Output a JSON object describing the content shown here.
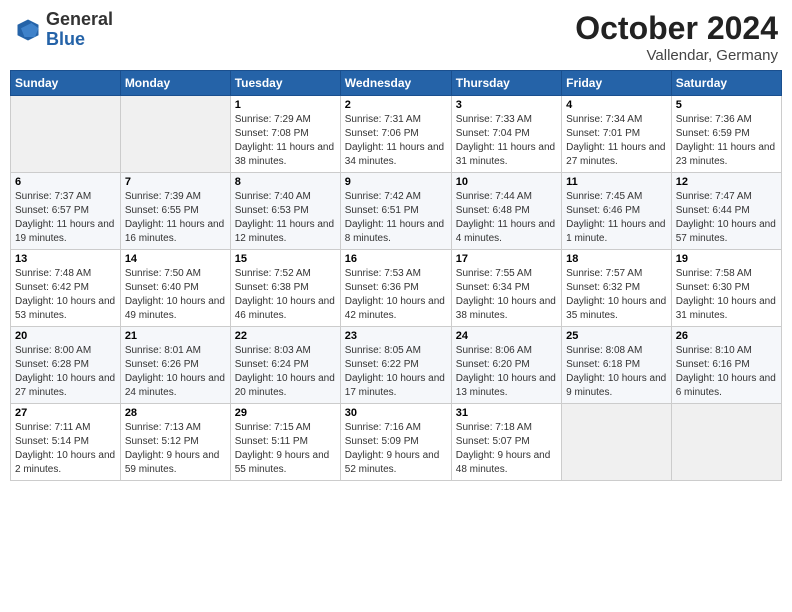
{
  "header": {
    "logo_general": "General",
    "logo_blue": "Blue",
    "month": "October 2024",
    "location": "Vallendar, Germany"
  },
  "weekdays": [
    "Sunday",
    "Monday",
    "Tuesday",
    "Wednesday",
    "Thursday",
    "Friday",
    "Saturday"
  ],
  "weeks": [
    [
      {
        "day": "",
        "info": ""
      },
      {
        "day": "",
        "info": ""
      },
      {
        "day": "1",
        "sunrise": "7:29 AM",
        "sunset": "7:08 PM",
        "daylight": "11 hours and 38 minutes."
      },
      {
        "day": "2",
        "sunrise": "7:31 AM",
        "sunset": "7:06 PM",
        "daylight": "11 hours and 34 minutes."
      },
      {
        "day": "3",
        "sunrise": "7:33 AM",
        "sunset": "7:04 PM",
        "daylight": "11 hours and 31 minutes."
      },
      {
        "day": "4",
        "sunrise": "7:34 AM",
        "sunset": "7:01 PM",
        "daylight": "11 hours and 27 minutes."
      },
      {
        "day": "5",
        "sunrise": "7:36 AM",
        "sunset": "6:59 PM",
        "daylight": "11 hours and 23 minutes."
      }
    ],
    [
      {
        "day": "6",
        "sunrise": "7:37 AM",
        "sunset": "6:57 PM",
        "daylight": "11 hours and 19 minutes."
      },
      {
        "day": "7",
        "sunrise": "7:39 AM",
        "sunset": "6:55 PM",
        "daylight": "11 hours and 16 minutes."
      },
      {
        "day": "8",
        "sunrise": "7:40 AM",
        "sunset": "6:53 PM",
        "daylight": "11 hours and 12 minutes."
      },
      {
        "day": "9",
        "sunrise": "7:42 AM",
        "sunset": "6:51 PM",
        "daylight": "11 hours and 8 minutes."
      },
      {
        "day": "10",
        "sunrise": "7:44 AM",
        "sunset": "6:48 PM",
        "daylight": "11 hours and 4 minutes."
      },
      {
        "day": "11",
        "sunrise": "7:45 AM",
        "sunset": "6:46 PM",
        "daylight": "11 hours and 1 minute."
      },
      {
        "day": "12",
        "sunrise": "7:47 AM",
        "sunset": "6:44 PM",
        "daylight": "10 hours and 57 minutes."
      }
    ],
    [
      {
        "day": "13",
        "sunrise": "7:48 AM",
        "sunset": "6:42 PM",
        "daylight": "10 hours and 53 minutes."
      },
      {
        "day": "14",
        "sunrise": "7:50 AM",
        "sunset": "6:40 PM",
        "daylight": "10 hours and 49 minutes."
      },
      {
        "day": "15",
        "sunrise": "7:52 AM",
        "sunset": "6:38 PM",
        "daylight": "10 hours and 46 minutes."
      },
      {
        "day": "16",
        "sunrise": "7:53 AM",
        "sunset": "6:36 PM",
        "daylight": "10 hours and 42 minutes."
      },
      {
        "day": "17",
        "sunrise": "7:55 AM",
        "sunset": "6:34 PM",
        "daylight": "10 hours and 38 minutes."
      },
      {
        "day": "18",
        "sunrise": "7:57 AM",
        "sunset": "6:32 PM",
        "daylight": "10 hours and 35 minutes."
      },
      {
        "day": "19",
        "sunrise": "7:58 AM",
        "sunset": "6:30 PM",
        "daylight": "10 hours and 31 minutes."
      }
    ],
    [
      {
        "day": "20",
        "sunrise": "8:00 AM",
        "sunset": "6:28 PM",
        "daylight": "10 hours and 27 minutes."
      },
      {
        "day": "21",
        "sunrise": "8:01 AM",
        "sunset": "6:26 PM",
        "daylight": "10 hours and 24 minutes."
      },
      {
        "day": "22",
        "sunrise": "8:03 AM",
        "sunset": "6:24 PM",
        "daylight": "10 hours and 20 minutes."
      },
      {
        "day": "23",
        "sunrise": "8:05 AM",
        "sunset": "6:22 PM",
        "daylight": "10 hours and 17 minutes."
      },
      {
        "day": "24",
        "sunrise": "8:06 AM",
        "sunset": "6:20 PM",
        "daylight": "10 hours and 13 minutes."
      },
      {
        "day": "25",
        "sunrise": "8:08 AM",
        "sunset": "6:18 PM",
        "daylight": "10 hours and 9 minutes."
      },
      {
        "day": "26",
        "sunrise": "8:10 AM",
        "sunset": "6:16 PM",
        "daylight": "10 hours and 6 minutes."
      }
    ],
    [
      {
        "day": "27",
        "sunrise": "7:11 AM",
        "sunset": "5:14 PM",
        "daylight": "10 hours and 2 minutes."
      },
      {
        "day": "28",
        "sunrise": "7:13 AM",
        "sunset": "5:12 PM",
        "daylight": "9 hours and 59 minutes."
      },
      {
        "day": "29",
        "sunrise": "7:15 AM",
        "sunset": "5:11 PM",
        "daylight": "9 hours and 55 minutes."
      },
      {
        "day": "30",
        "sunrise": "7:16 AM",
        "sunset": "5:09 PM",
        "daylight": "9 hours and 52 minutes."
      },
      {
        "day": "31",
        "sunrise": "7:18 AM",
        "sunset": "5:07 PM",
        "daylight": "9 hours and 48 minutes."
      },
      {
        "day": "",
        "info": ""
      },
      {
        "day": "",
        "info": ""
      }
    ]
  ],
  "labels": {
    "sunrise_prefix": "Sunrise: ",
    "sunset_prefix": "Sunset: ",
    "daylight_prefix": "Daylight: "
  }
}
